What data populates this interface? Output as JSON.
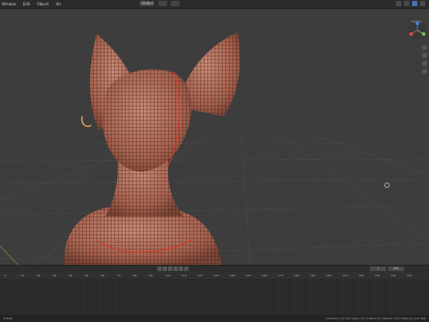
{
  "header": {
    "menu": [
      "Window",
      "Edit",
      "Object",
      "Vis"
    ],
    "mode": "Global",
    "view_label": "Options"
  },
  "timeline": {
    "ticks": [
      "0",
      "10",
      "20",
      "30",
      "40",
      "50",
      "60",
      "70",
      "80",
      "90",
      "100",
      "110",
      "120",
      "130",
      "140",
      "150",
      "160",
      "170",
      "180",
      "190",
      "200",
      "210",
      "220",
      "230",
      "240",
      "250"
    ],
    "frame_start": "1",
    "frame_end": "250"
  },
  "viewport": {
    "side_label": "Options"
  },
  "status": {
    "left": "Rotate",
    "right": "Armature | Fix the mesh | Tris 4,446,276 | Objects 1/13 | Memory 3.27 GiB"
  },
  "colors": {
    "skin": "#b86f5a",
    "wire": "#1a1a1a",
    "seam": "#d23a2a"
  }
}
